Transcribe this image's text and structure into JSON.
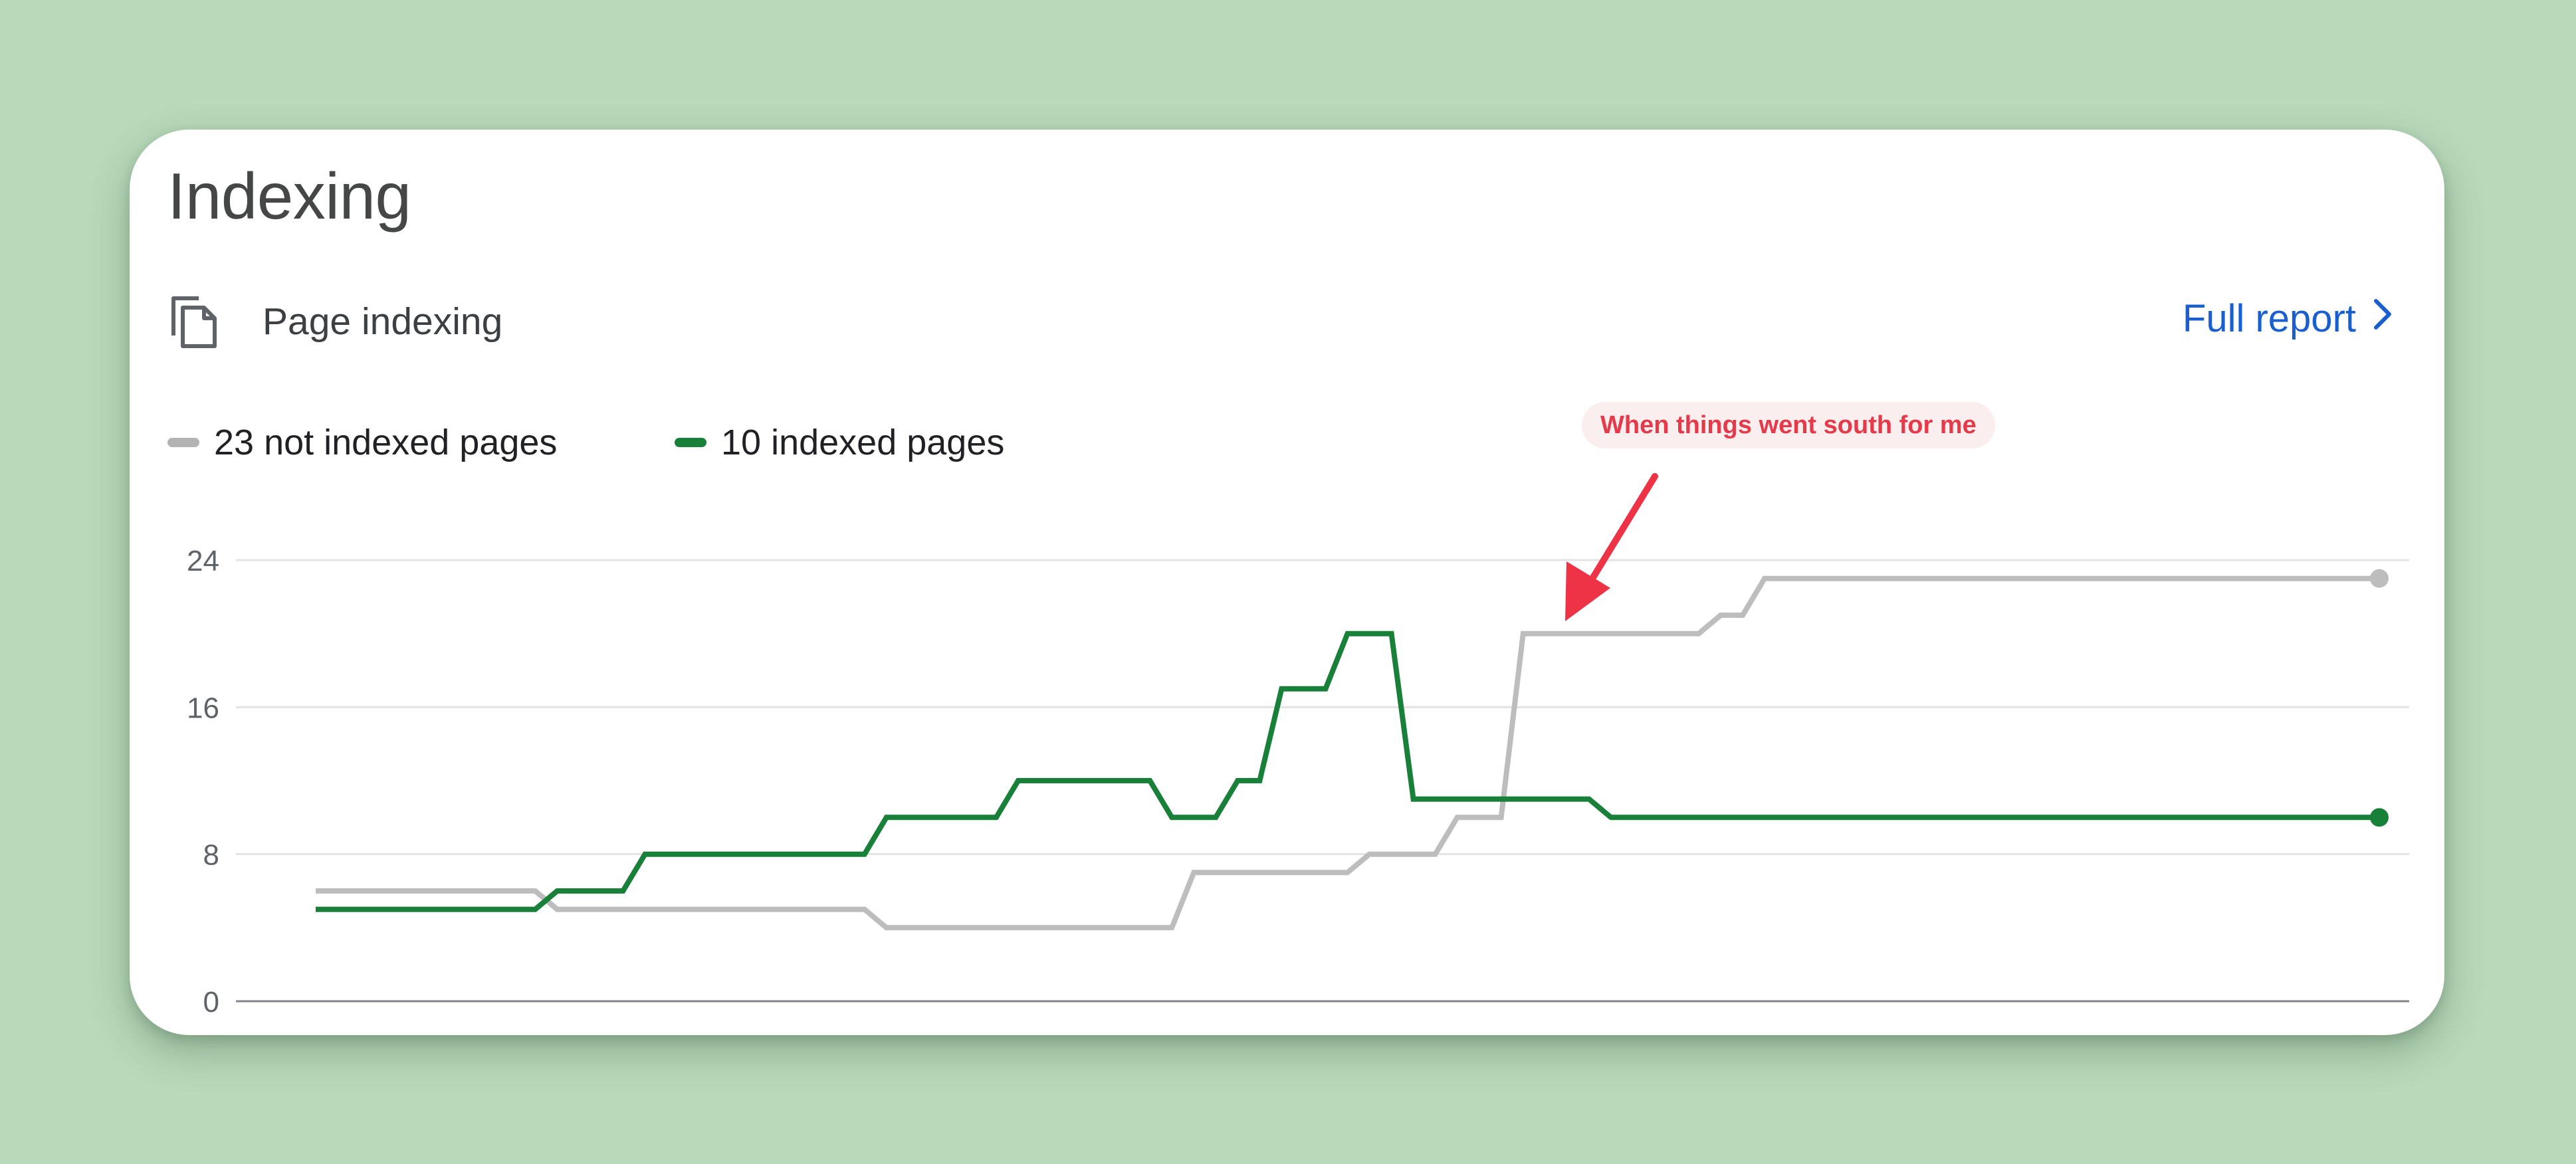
{
  "card": {
    "title": "Indexing",
    "section_label": "Page indexing",
    "full_report_label": "Full report"
  },
  "icons": {
    "page": "copy-pages-icon",
    "chevron": "chevron-right-icon",
    "arrow": "annotation-arrow-icon"
  },
  "legend": {
    "not_indexed": "23 not indexed pages",
    "indexed": "10 indexed pages"
  },
  "annotation": {
    "text": "When things went south for me"
  },
  "colors": {
    "background": "#b9d9bb",
    "not_indexed": "#bdbdbd",
    "indexed": "#188038",
    "link": "#1a5fd0",
    "annotation": "#ee3347"
  },
  "chart_data": {
    "type": "line",
    "x": [
      0,
      1,
      2,
      3,
      4,
      5,
      6,
      7,
      8,
      9,
      10,
      11,
      12,
      13,
      14,
      15,
      16,
      17,
      18,
      19,
      20,
      21,
      22,
      23,
      24,
      25,
      26,
      27,
      28,
      29,
      30,
      31,
      32,
      33,
      34,
      35,
      36,
      37,
      38,
      39,
      40,
      41,
      42,
      43,
      44,
      45,
      46,
      47,
      48,
      49,
      50,
      51,
      52,
      53,
      54,
      55,
      56,
      57,
      58,
      59,
      60,
      61,
      62,
      63,
      64,
      65,
      66,
      67,
      68,
      69,
      70,
      71,
      72,
      73,
      74,
      75,
      76,
      77,
      78,
      79,
      80,
      81,
      82,
      83,
      84,
      85,
      86,
      87,
      88,
      89,
      90,
      91,
      92,
      93,
      94
    ],
    "series": [
      {
        "name": "23 not indexed pages",
        "color": "#bdbdbd",
        "values": [
          6,
          6,
          6,
          6,
          6,
          6,
          6,
          6,
          6,
          6,
          6,
          5,
          5,
          5,
          5,
          5,
          5,
          5,
          5,
          5,
          5,
          5,
          5,
          5,
          5,
          5,
          4,
          4,
          4,
          4,
          4,
          4,
          4,
          4,
          4,
          4,
          4,
          4,
          4,
          4,
          7,
          7,
          7,
          7,
          7,
          7,
          7,
          7,
          8,
          8,
          8,
          8,
          10,
          10,
          10,
          20,
          20,
          20,
          20,
          20,
          20,
          20,
          20,
          20,
          21,
          21,
          23,
          23,
          23,
          23,
          23,
          23,
          23,
          23,
          23,
          23,
          23,
          23,
          23,
          23,
          23,
          23,
          23,
          23,
          23,
          23,
          23,
          23,
          23,
          23,
          23,
          23,
          23,
          23,
          23
        ]
      },
      {
        "name": "10 indexed pages",
        "color": "#188038",
        "values": [
          5,
          5,
          5,
          5,
          5,
          5,
          5,
          5,
          5,
          5,
          5,
          6,
          6,
          6,
          6,
          8,
          8,
          8,
          8,
          8,
          8,
          8,
          8,
          8,
          8,
          8,
          10,
          10,
          10,
          10,
          10,
          10,
          12,
          12,
          12,
          12,
          12,
          12,
          12,
          10,
          10,
          10,
          12,
          12,
          17,
          17,
          17,
          20,
          20,
          20,
          11,
          11,
          11,
          11,
          11,
          11,
          11,
          11,
          11,
          10,
          10,
          10,
          10,
          10,
          10,
          10,
          10,
          10,
          10,
          10,
          10,
          10,
          10,
          10,
          10,
          10,
          10,
          10,
          10,
          10,
          10,
          10,
          10,
          10,
          10,
          10,
          10,
          10,
          10,
          10,
          10,
          10,
          10,
          10,
          10
        ]
      }
    ],
    "ylim": [
      0,
      24
    ],
    "yticks": [
      "24",
      "16",
      "8",
      "0"
    ],
    "grid": true,
    "legend": "top-left"
  }
}
